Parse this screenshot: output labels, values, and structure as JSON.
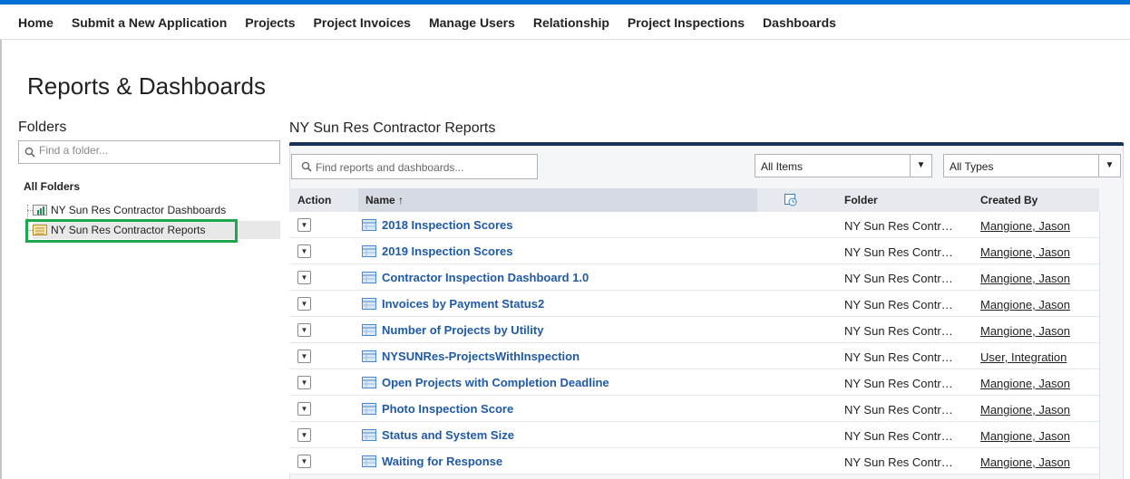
{
  "nav": {
    "items": [
      "Home",
      "Submit a New Application",
      "Projects",
      "Project Invoices",
      "Manage Users",
      "Relationship",
      "Project Inspections",
      "Dashboards"
    ]
  },
  "page": {
    "title": "Reports & Dashboards"
  },
  "folders": {
    "title": "Folders",
    "search_placeholder": "Find a folder...",
    "all_label": "All Folders",
    "items": [
      {
        "label": "NY Sun Res Contractor Dashboards",
        "icon": "dashboard-folder-icon"
      },
      {
        "label": "NY Sun Res Contractor Reports",
        "icon": "report-folder-icon",
        "selected": true
      }
    ]
  },
  "reports": {
    "title": "NY Sun Res Contractor Reports",
    "search_placeholder": "Find reports and dashboards...",
    "filter_items": "All Items",
    "filter_types": "All Types",
    "columns": {
      "action": "Action",
      "name": "Name",
      "sort": "↑",
      "folder": "Folder",
      "created_by": "Created By"
    },
    "rows": [
      {
        "name": "2018 Inspection Scores",
        "folder": "NY Sun Res Contr…",
        "created_by": "Mangione, Jason"
      },
      {
        "name": "2019 Inspection Scores",
        "folder": "NY Sun Res Contr…",
        "created_by": "Mangione, Jason"
      },
      {
        "name": "Contractor Inspection Dashboard 1.0",
        "folder": "NY Sun Res Contr…",
        "created_by": "Mangione, Jason"
      },
      {
        "name": "Invoices by Payment Status2",
        "folder": "NY Sun Res Contr…",
        "created_by": "Mangione, Jason"
      },
      {
        "name": "Number of Projects by Utility",
        "folder": "NY Sun Res Contr…",
        "created_by": "Mangione, Jason"
      },
      {
        "name": "NYSUNRes-ProjectsWithInspection",
        "folder": "NY Sun Res Contr…",
        "created_by": "User, Integration"
      },
      {
        "name": "Open Projects with Completion Deadline",
        "folder": "NY Sun Res Contr…",
        "created_by": "Mangione, Jason"
      },
      {
        "name": "Photo Inspection Score",
        "folder": "NY Sun Res Contr…",
        "created_by": "Mangione, Jason"
      },
      {
        "name": "Status and System Size",
        "folder": "NY Sun Res Contr…",
        "created_by": "Mangione, Jason"
      },
      {
        "name": "Waiting for Response",
        "folder": "NY Sun Res Contr…",
        "created_by": "Mangione, Jason"
      }
    ]
  },
  "colors": {
    "accent": "#0070d2",
    "link": "#1f5aa6",
    "header_bar": "#16325c",
    "selection": "#1ea74b"
  }
}
